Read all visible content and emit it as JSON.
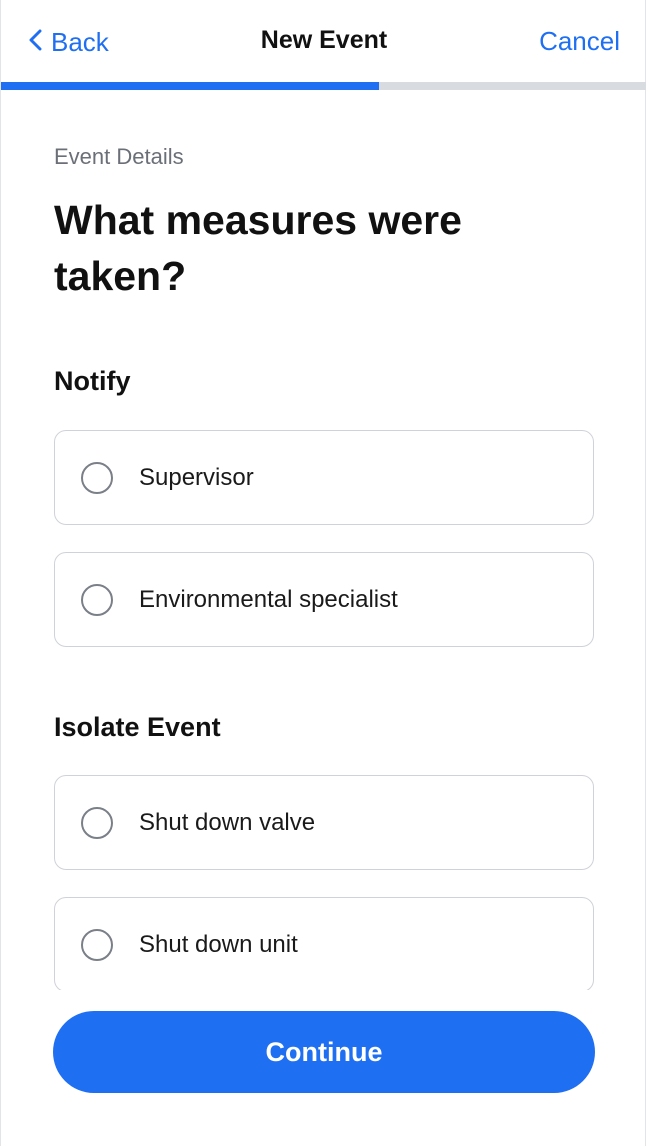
{
  "header": {
    "back_label": "Back",
    "title": "New Event",
    "cancel_label": "Cancel"
  },
  "progress": {
    "fraction": 0.585,
    "fill_color": "#1f6ff2",
    "track_color": "#d8dbe0"
  },
  "content": {
    "section_label": "Event Details",
    "question": "What measures were taken?",
    "groups": [
      {
        "title": "Notify",
        "options": [
          {
            "label": "Supervisor",
            "selected": false
          },
          {
            "label": "Environmental specialist",
            "selected": false
          }
        ]
      },
      {
        "title": "Isolate Event",
        "options": [
          {
            "label": "Shut down valve",
            "selected": false
          },
          {
            "label": "Shut down unit",
            "selected": false
          }
        ]
      }
    ]
  },
  "footer": {
    "continue_label": "Continue"
  },
  "icons": {
    "back": "chevron-left-icon",
    "option": "radio-icon"
  },
  "colors": {
    "accent": "#1f6ff2"
  }
}
